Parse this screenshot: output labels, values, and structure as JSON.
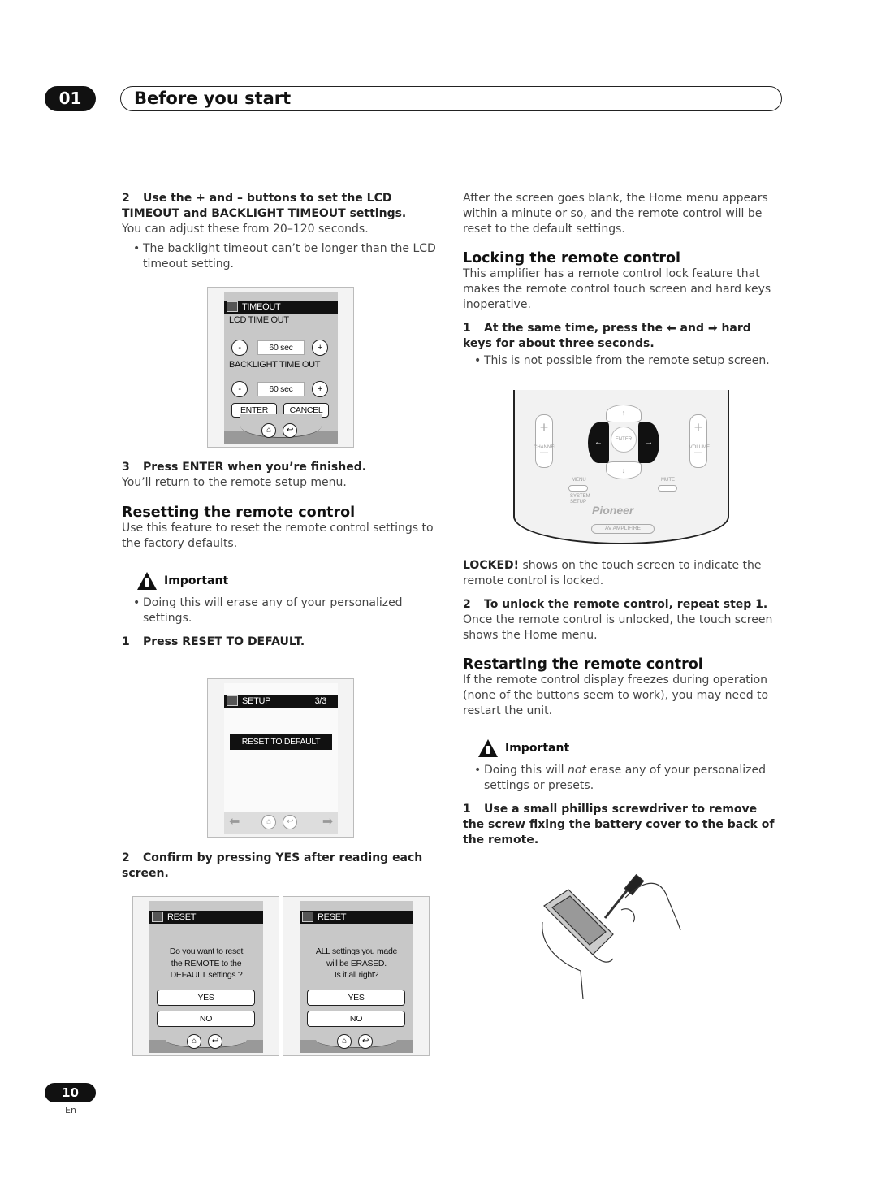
{
  "header": {
    "chapter": "01",
    "title": "Before you start"
  },
  "left": {
    "step2": {
      "num": "2",
      "text": "Use the + and – buttons to set the LCD TIMEOUT and BACKLIGHT TIMEOUT settings."
    },
    "step2_body": "You can adjust these from 20–120 seconds.",
    "step2_bullet": "The backlight timeout can’t be longer than the LCD timeout setting.",
    "lcd_timeout": {
      "title": "TIMEOUT",
      "lcd_label": "LCD TIME OUT",
      "lcd_value": "60 sec",
      "backlight_label": "BACKLIGHT TIME OUT",
      "backlight_value": "60 sec",
      "minus": "-",
      "plus": "+",
      "enter": "ENTER",
      "cancel": "CANCEL"
    },
    "step3": {
      "num": "3",
      "text": "Press ENTER when you’re finished."
    },
    "step3_body": "You’ll return to the remote setup menu.",
    "reset_heading": "Resetting the remote control",
    "reset_body": "Use this feature to reset the remote control settings to the factory defaults.",
    "important": "Important",
    "reset_bullet": "Doing this will erase any of your personalized settings.",
    "reset_step1": {
      "num": "1",
      "text": "Press RESET TO DEFAULT."
    },
    "lcd_setup": {
      "title": "SETUP",
      "page": "3/3",
      "button": "RESET TO DEFAULT"
    },
    "reset_step2": {
      "num": "2",
      "text": "Confirm by pressing YES after reading each screen."
    },
    "lcd_reset1": {
      "title": "RESET",
      "line1": "Do you want to reset",
      "line2": "the REMOTE to the",
      "line3": "DEFAULT settings ?",
      "yes": "YES",
      "no": "NO"
    },
    "lcd_reset2": {
      "title": "RESET",
      "line1": "ALL settings you made",
      "line2": "will be ERASED.",
      "line3": "Is it all right?",
      "yes": "YES",
      "no": "NO"
    }
  },
  "right": {
    "intro": "After the screen goes blank, the Home menu appears within a minute or so, and the remote control will be reset to the default settings.",
    "lock_heading": "Locking the remote control",
    "lock_body": "This amplifier has a remote control lock feature that makes the remote control touch screen and hard keys inoperative.",
    "lock_step1": {
      "num": "1",
      "a": "At the same time, press the",
      "b": "and",
      "c": "hard keys for about three seconds."
    },
    "lock_bullet": "This is not possible from the remote setup screen.",
    "remote": {
      "enter": "ENTER",
      "channel": "CHANNEL",
      "volume": "VOLUME",
      "menu": "MENU",
      "system_setup": "SYSTEM SETUP",
      "mute": "MUTE",
      "brand": "Pioneer",
      "model": "AV AMPLIFIRE"
    },
    "locked_bold": "LOCKED!",
    "locked_text": " shows on the touch screen to indicate the remote control is locked.",
    "lock_step2": {
      "num": "2",
      "text": "To unlock the remote control, repeat step 1."
    },
    "lock_step2_body": "Once the remote control is unlocked, the touch screen shows the Home menu.",
    "restart_heading": "Restarting the remote control",
    "restart_body": "If the remote control display freezes during operation (none of the buttons seem to work), you may need to restart the unit.",
    "important": "Important",
    "restart_bullet_a": "Doing this will ",
    "restart_bullet_em": "not",
    "restart_bullet_b": " erase any of your personalized settings or presets.",
    "restart_step1": {
      "num": "1",
      "text": "Use a small phillips screwdriver to remove the screw fixing the battery cover to the back of the remote."
    }
  },
  "footer": {
    "page": "10",
    "lang": "En"
  }
}
